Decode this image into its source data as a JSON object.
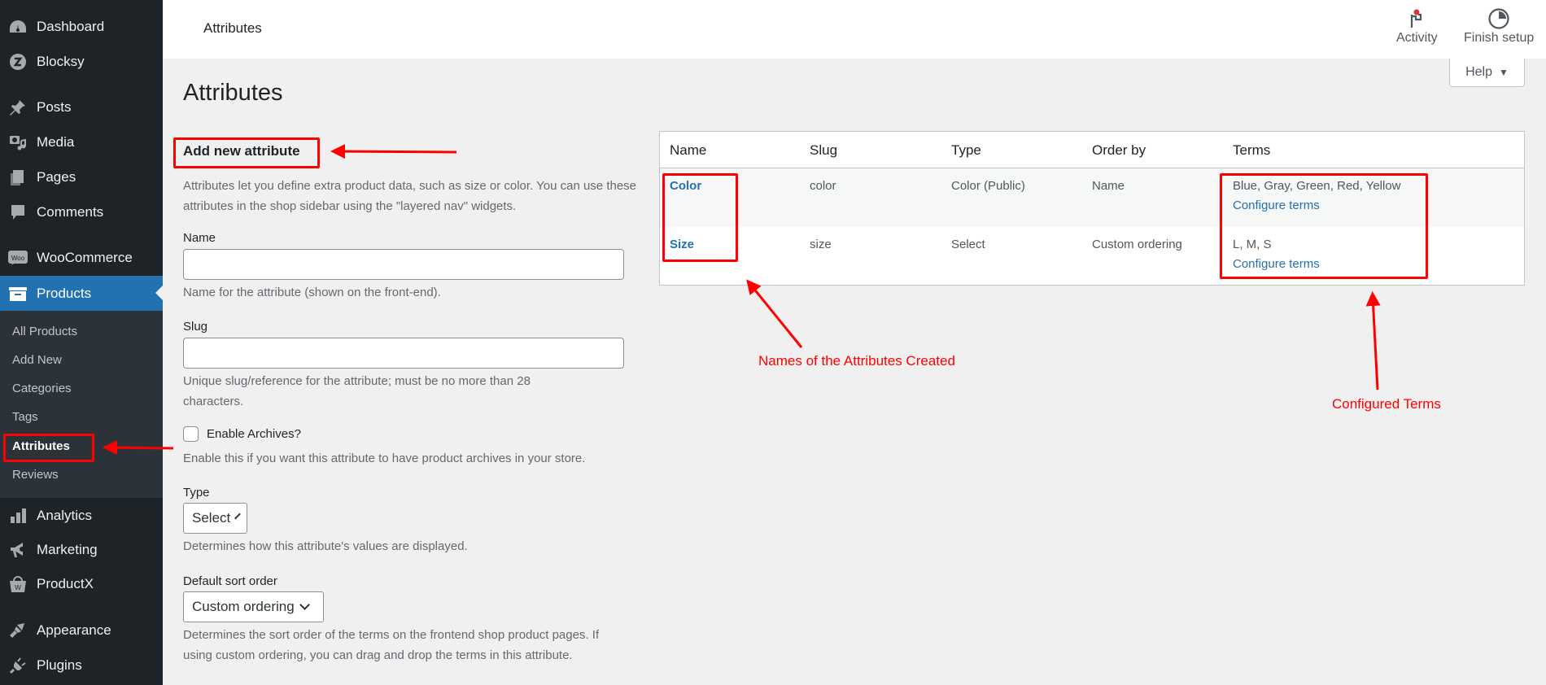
{
  "sidebar": {
    "items": [
      {
        "label": "Dashboard",
        "icon": "dashboard-icon"
      },
      {
        "label": "Blocksy",
        "icon": "blocksy-icon"
      },
      {
        "label": "Posts",
        "icon": "pin-icon"
      },
      {
        "label": "Media",
        "icon": "media-icon"
      },
      {
        "label": "Pages",
        "icon": "pages-icon"
      },
      {
        "label": "Comments",
        "icon": "comment-icon"
      },
      {
        "label": "WooCommerce",
        "icon": "woo-icon"
      },
      {
        "label": "Products",
        "icon": "archive-box-icon",
        "active": true
      },
      {
        "label": "Analytics",
        "icon": "bar-chart-icon"
      },
      {
        "label": "Marketing",
        "icon": "megaphone-icon"
      },
      {
        "label": "ProductX",
        "icon": "bag-icon"
      },
      {
        "label": "Appearance",
        "icon": "paintbrush-icon"
      },
      {
        "label": "Plugins",
        "icon": "plug-icon"
      }
    ],
    "submenu": [
      "All Products",
      "Add New",
      "Categories",
      "Tags",
      "Attributes",
      "Reviews"
    ],
    "submenu_current": "Attributes"
  },
  "topbar": {
    "title": "Attributes",
    "activity_label": "Activity",
    "finish_setup_label": "Finish setup",
    "help_label": "Help"
  },
  "page": {
    "title": "Attributes"
  },
  "form": {
    "heading": "Add new attribute",
    "intro": "Attributes let you define extra product data, such as size or color. You can use these attributes in the shop sidebar using the \"layered nav\" widgets.",
    "name_label": "Name",
    "name_value": "",
    "name_help": "Name for the attribute (shown on the front-end).",
    "slug_label": "Slug",
    "slug_value": "",
    "slug_help": "Unique slug/reference for the attribute; must be no more than 28 characters.",
    "archives_label": "Enable Archives?",
    "archives_checked": false,
    "archives_help": "Enable this if you want this attribute to have product archives in your store.",
    "type_label": "Type",
    "type_value": "Select",
    "type_help": "Determines how this attribute's values are displayed.",
    "sort_label": "Default sort order",
    "sort_value": "Custom ordering",
    "sort_help": "Determines the sort order of the terms on the frontend shop product pages. If using custom ordering, you can drag and drop the terms in this attribute."
  },
  "table": {
    "headers": [
      "Name",
      "Slug",
      "Type",
      "Order by",
      "Terms"
    ],
    "rows": [
      {
        "name": "Color",
        "slug": "color",
        "type": "Color (Public)",
        "order_by": "Name",
        "terms": "Blue, Gray, Green, Red, Yellow",
        "configure_label": "Configure terms"
      },
      {
        "name": "Size",
        "slug": "size",
        "type": "Select",
        "order_by": "Custom ordering",
        "terms": "L, M, S",
        "configure_label": "Configure terms"
      }
    ]
  },
  "annotations": {
    "names_label": "Names of the Attributes Created",
    "terms_label": "Configured Terms",
    "color": "#ff0000"
  },
  "colors": {
    "sidebar_bg": "#1d2327",
    "submenu_bg": "#2c3338",
    "accent": "#2271b1",
    "page_bg": "#f0f0f1"
  }
}
